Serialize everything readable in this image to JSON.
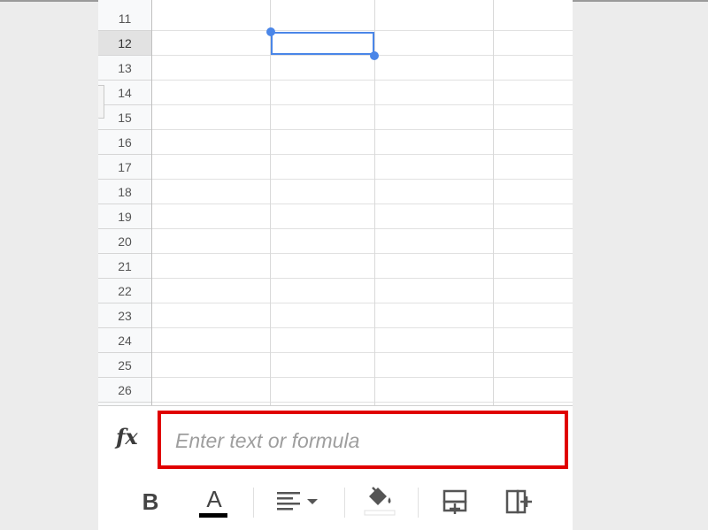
{
  "grid": {
    "rows": [
      "11",
      "12",
      "13",
      "14",
      "15",
      "16",
      "17",
      "18",
      "19",
      "20",
      "21",
      "22",
      "23",
      "24",
      "25",
      "26"
    ],
    "selected_row": "12"
  },
  "formula_bar": {
    "fx_label": "fx",
    "placeholder": "Enter text or formula",
    "value": ""
  },
  "toolbar": {
    "bold_label": "B",
    "text_color_label": "A",
    "text_color": "#000000",
    "buttons": [
      "bold-icon",
      "text-color-icon",
      "align-icon",
      "fill-color-icon",
      "insert-row-icon",
      "insert-column-icon"
    ]
  },
  "colors": {
    "selection": "#4a86e8",
    "highlight": "#e00000"
  }
}
